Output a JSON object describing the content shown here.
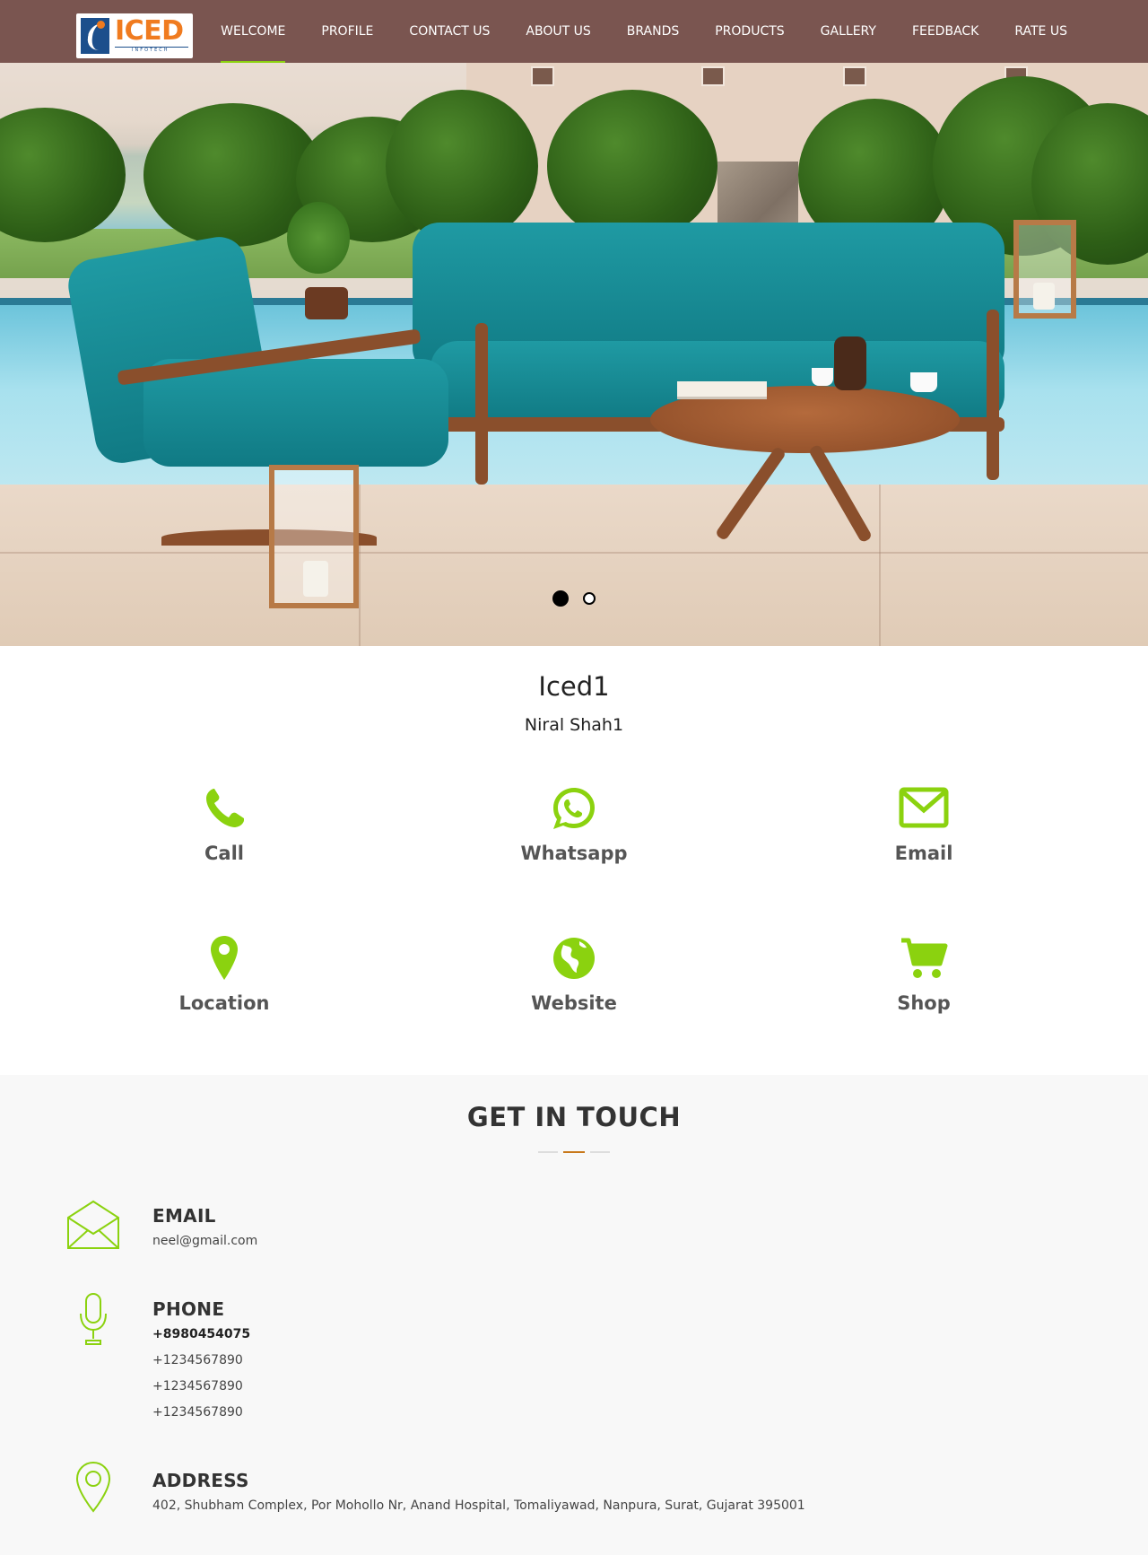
{
  "brand": {
    "logo_text": "ICED",
    "logo_sub": "INFOTECH"
  },
  "nav": {
    "items": [
      {
        "label": "WELCOME",
        "active": true
      },
      {
        "label": "PROFILE"
      },
      {
        "label": "CONTACT US"
      },
      {
        "label": "ABOUT US"
      },
      {
        "label": "BRANDS"
      },
      {
        "label": "PRODUCTS"
      },
      {
        "label": "GALLERY"
      },
      {
        "label": "FEEDBACK"
      },
      {
        "label": "RATE US"
      }
    ]
  },
  "slider": {
    "slide_count": 2,
    "active_index": 0
  },
  "profile": {
    "business_name": "Iced1",
    "person_name": "Niral Shah1"
  },
  "actions": [
    {
      "label": "Call",
      "icon": "phone-icon"
    },
    {
      "label": "Whatsapp",
      "icon": "whatsapp-icon"
    },
    {
      "label": "Email",
      "icon": "envelope-icon"
    },
    {
      "label": "Location",
      "icon": "map-pin-icon"
    },
    {
      "label": "Website",
      "icon": "globe-icon"
    },
    {
      "label": "Shop",
      "icon": "cart-icon"
    }
  ],
  "contact": {
    "title": "GET IN TOUCH",
    "email": {
      "heading": "EMAIL",
      "value": "neel@gmail.com"
    },
    "phone": {
      "heading": "PHONE",
      "numbers": [
        "+8980454075",
        "+1234567890",
        "+1234567890",
        "+1234567890"
      ]
    },
    "address": {
      "heading": "ADDRESS",
      "value": "402, Shubham Complex, Por Mohollo Nr, Anand Hospital, Tomaliyawad, Nanpura, Surat, Gujarat 395001"
    }
  },
  "colors": {
    "nav_bg": "#7a5550",
    "accent_green": "#8bd20f",
    "accent_orange": "#c8781a",
    "section_bg": "#f8f8f8"
  }
}
